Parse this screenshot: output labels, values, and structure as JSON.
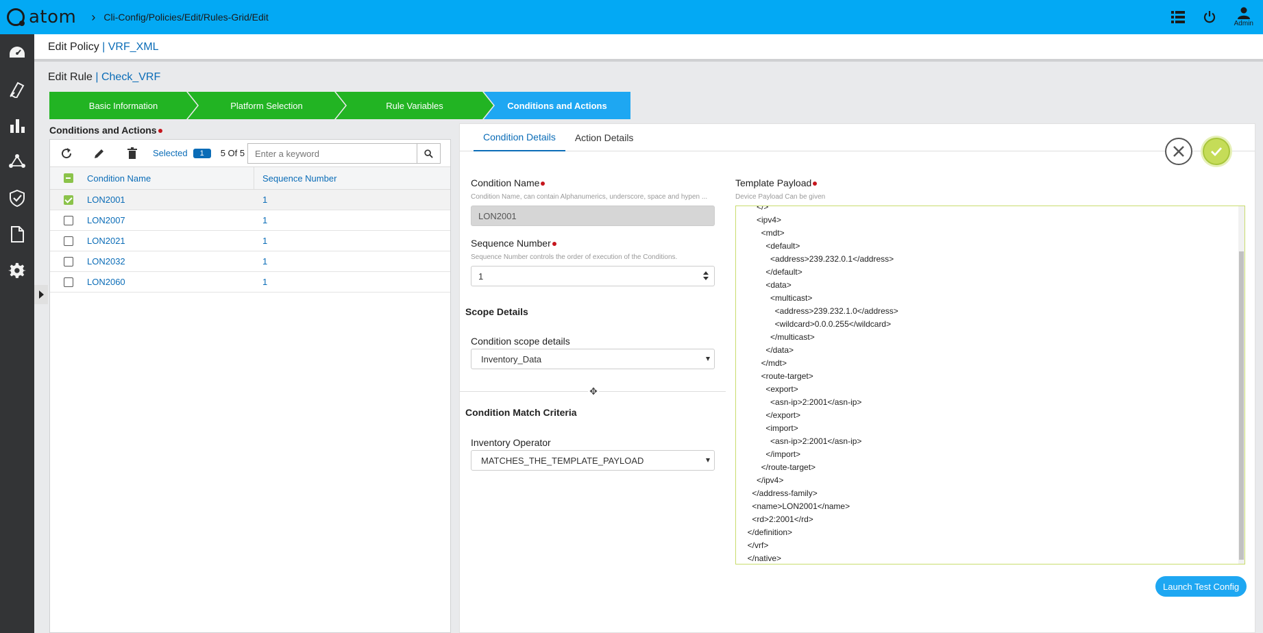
{
  "app": {
    "logo_text": "atom",
    "breadcrumb_sep": "›",
    "breadcrumb": "Cli-Config/Policies/Edit/Rules-Grid/Edit"
  },
  "topbar": {
    "admin_label": "Admin"
  },
  "policy": {
    "prefix": "Edit Policy",
    "sep": " | ",
    "name": "VRF_XML"
  },
  "rule": {
    "prefix": "Edit Rule",
    "sep": " | ",
    "name": "Check_VRF"
  },
  "stepper": {
    "steps": [
      {
        "label": "Basic Information",
        "status": "complete"
      },
      {
        "label": "Platform Selection",
        "status": "complete"
      },
      {
        "label": "Rule Variables",
        "status": "complete"
      },
      {
        "label": "Conditions and Actions",
        "status": "active"
      }
    ]
  },
  "left": {
    "title": "Conditions and Actions",
    "selected_label": "Selected",
    "selected_count": "1",
    "count_text": "5 Of 5",
    "search_placeholder": "Enter a keyword",
    "columns": {
      "name": "Condition Name",
      "seq": "Sequence Number"
    },
    "rows": [
      {
        "name": "LON2001",
        "seq": "1",
        "checked": true
      },
      {
        "name": "LON2007",
        "seq": "1",
        "checked": false
      },
      {
        "name": "LON2021",
        "seq": "1",
        "checked": false
      },
      {
        "name": "LON2032",
        "seq": "1",
        "checked": false
      },
      {
        "name": "LON2060",
        "seq": "1",
        "checked": false
      }
    ]
  },
  "right": {
    "tabs": [
      {
        "label": "Condition Details",
        "active": true
      },
      {
        "label": "Action Details",
        "active": false
      }
    ],
    "condition_name": {
      "label": "Condition Name",
      "help": "Condition Name, can contain Alphanumerics, underscore, space and hypen ...",
      "value": "LON2001"
    },
    "sequence_number": {
      "label": "Sequence Number",
      "help": "Sequence Number controls the order of execution of the Conditions.",
      "value": "1"
    },
    "scope_section": "Scope Details",
    "scope": {
      "label": "Condition scope details",
      "value": "Inventory_Data"
    },
    "match_section": "Condition Match Criteria",
    "operator": {
      "label": "Inventory Operator",
      "value": "MATCHES_THE_TEMPLATE_PAYLOAD"
    },
    "payload": {
      "label": "Template Payload",
      "help": "Device Payload Can be given",
      "text": "      </>\n      <ipv4>\n        <mdt>\n          <default>\n            <address>239.232.0.1</address>\n          </default>\n          <data>\n            <multicast>\n              <address>239.232.1.0</address>\n              <wildcard>0.0.0.255</wildcard>\n            </multicast>\n          </data>\n        </mdt>\n        <route-target>\n          <export>\n            <asn-ip>2:2001</asn-ip>\n          </export>\n          <import>\n            <asn-ip>2:2001</asn-ip>\n          </import>\n        </route-target>\n      </ipv4>\n    </address-family>\n    <name>LON2001</name>\n    <rd>2:2001</rd>\n  </definition>\n  </vrf>\n  </native>"
    },
    "launch_button": "Launch Test Config"
  }
}
